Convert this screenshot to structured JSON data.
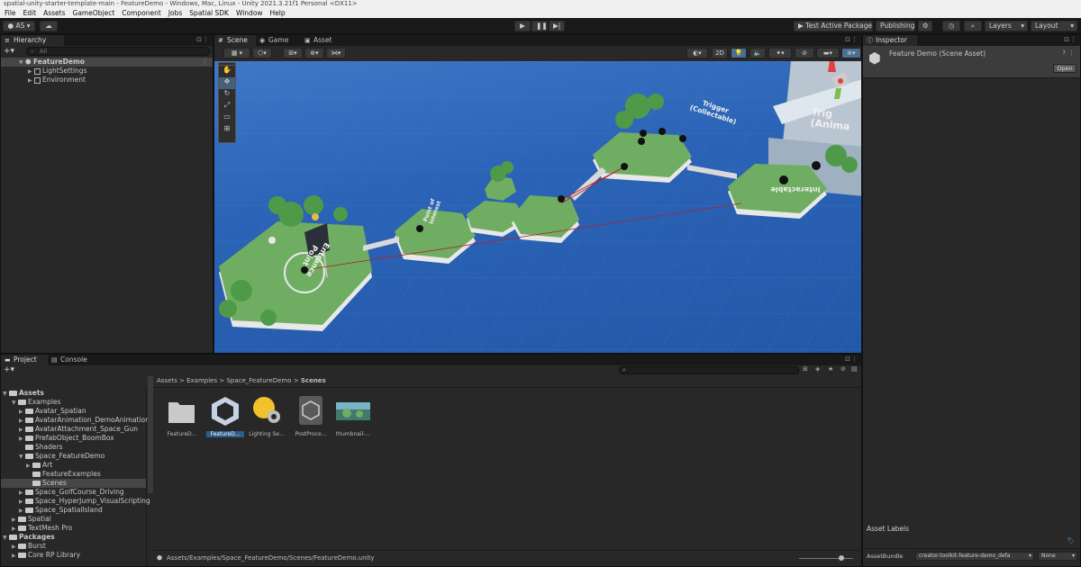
{
  "window": {
    "title": "spatial-unity-starter-template-main - FeatureDemo - Windows, Mac, Linux - Unity 2021.3.21f1 Personal <DX11>"
  },
  "menu": [
    "File",
    "Edit",
    "Assets",
    "GameObject",
    "Component",
    "Jobs",
    "Spatial SDK",
    "Window",
    "Help"
  ],
  "toolbar": {
    "account_label": "AS",
    "test_label": "Test Active Package",
    "publishing_label": "Publishing",
    "layers_label": "Layers",
    "layout_label": "Layout"
  },
  "hierarchy": {
    "tab": "Hierarchy",
    "search_placeholder": "All",
    "scene": "FeatureDemo",
    "items": [
      "LightSettings",
      "Environment"
    ]
  },
  "scene_view": {
    "tabs": [
      "Scene",
      "Game",
      "Asset Store"
    ],
    "btn_2d": "2D",
    "labels": {
      "trigger": "Trigger\n(Collectable)",
      "trigger_anim": "Trig\n(Anima",
      "interactable": "Interactable",
      "entrance": "Entrance\nPoint",
      "point_of_interest": "Point of\nInterest"
    }
  },
  "inspector": {
    "tab": "Inspector",
    "title": "Feature Demo (Scene Asset)",
    "open_label": "Open",
    "asset_labels": "Asset Labels",
    "asset_bundle_label": "AssetBundle",
    "asset_bundle_value": "creator-toolkit-feature-demo_defa",
    "variant_value": "None"
  },
  "project": {
    "tabs": [
      "Project",
      "Console"
    ],
    "tree": [
      {
        "label": "Assets",
        "depth": 0,
        "bold": true
      },
      {
        "label": "Examples",
        "depth": 1
      },
      {
        "label": "Avatar_Spatian",
        "depth": 2
      },
      {
        "label": "AvatarAnimation_DemoAnimation",
        "depth": 2
      },
      {
        "label": "AvatarAttachment_Space_Gun",
        "depth": 2
      },
      {
        "label": "PrefabObject_BoomBox",
        "depth": 2
      },
      {
        "label": "Shaders",
        "depth": 2
      },
      {
        "label": "Space_FeatureDemo",
        "depth": 2
      },
      {
        "label": "Art",
        "depth": 3
      },
      {
        "label": "FeatureExamples",
        "depth": 3
      },
      {
        "label": "Scenes",
        "depth": 3
      },
      {
        "label": "Space_GolfCourse_Driving",
        "depth": 2
      },
      {
        "label": "Space_HyperJump_VisualScripting",
        "depth": 2
      },
      {
        "label": "Space_SpatialIsland",
        "depth": 2
      },
      {
        "label": "Spatial",
        "depth": 1
      },
      {
        "label": "TextMesh Pro",
        "depth": 1
      },
      {
        "label": "Packages",
        "depth": 0,
        "bold": true
      },
      {
        "label": "Burst",
        "depth": 1
      },
      {
        "label": "Core RP Library",
        "depth": 1
      }
    ],
    "breadcrumb": [
      "Assets",
      "Examples",
      "Space_FeatureDemo",
      "Scenes"
    ],
    "assets": [
      {
        "name": "FeatureD...",
        "kind": "folder"
      },
      {
        "name": "FeatureD...",
        "kind": "unity"
      },
      {
        "name": "Lighting Se...",
        "kind": "lighting"
      },
      {
        "name": "PostProce...",
        "kind": "cube"
      },
      {
        "name": "thumbnail-...",
        "kind": "image"
      }
    ],
    "path": "Assets/Examples/Space_FeatureDemo/Scenes/FeatureDemo.unity"
  },
  "colors": {
    "accent": "#2c5d87",
    "sky": "#1f5fb0",
    "grass": "#6fae62"
  }
}
